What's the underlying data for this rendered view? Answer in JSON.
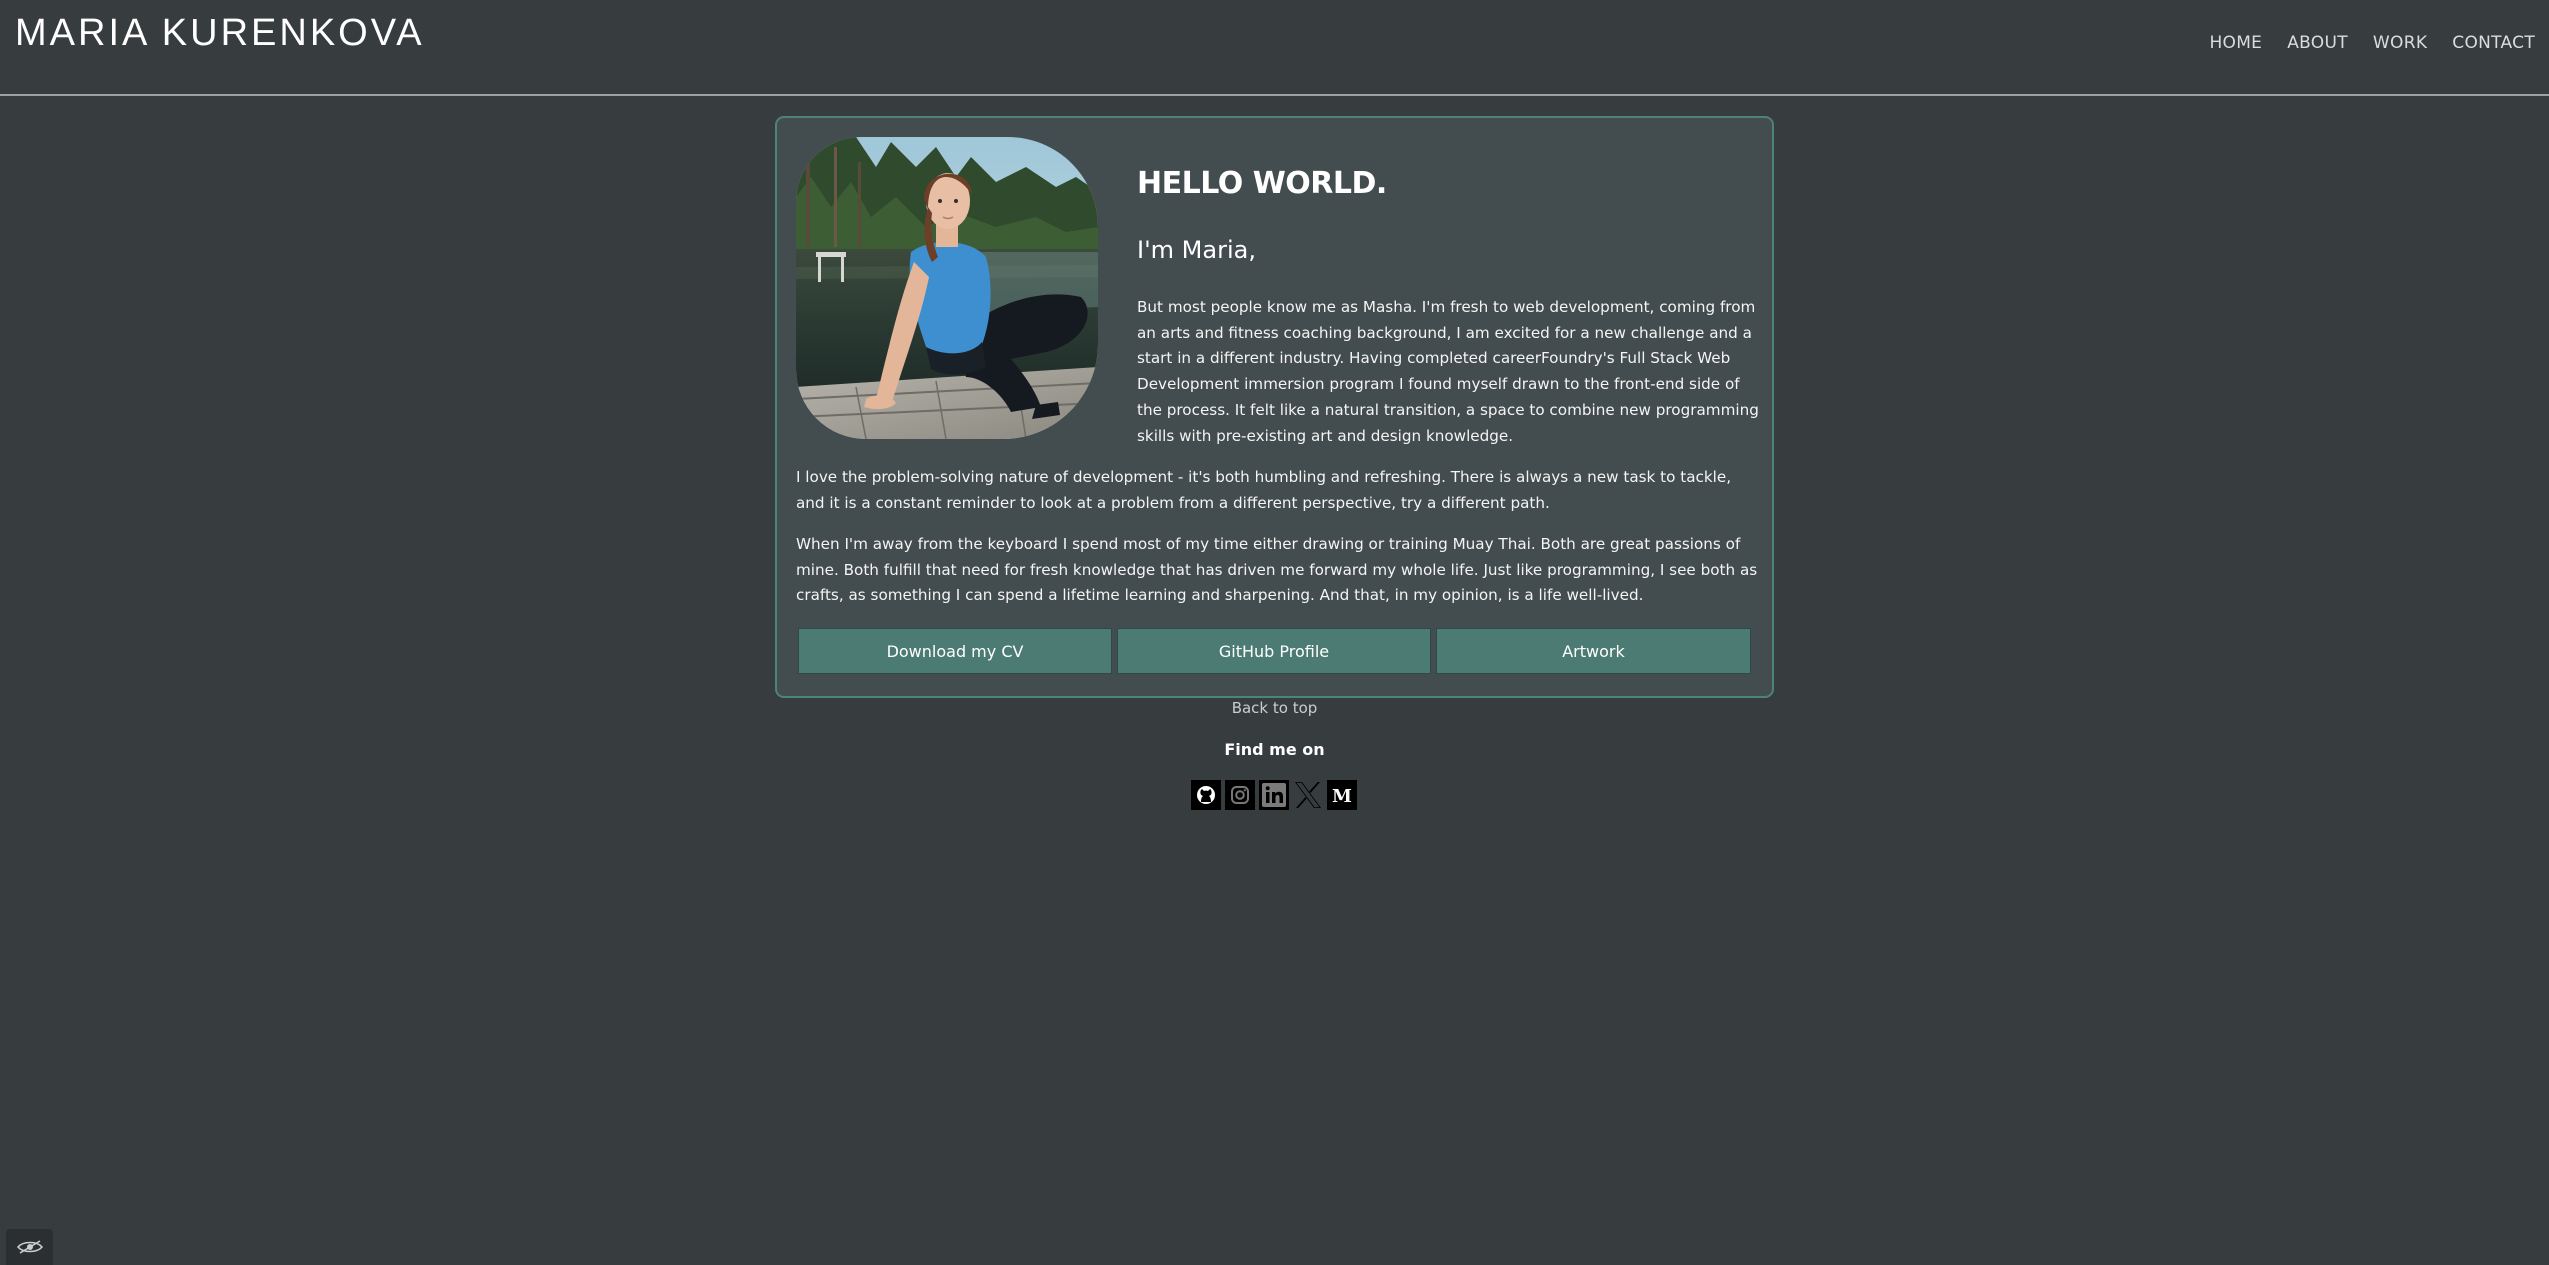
{
  "header": {
    "title": "MARIA KURENKOVA",
    "nav": [
      "HOME",
      "ABOUT",
      "WORK",
      "CONTACT"
    ]
  },
  "about": {
    "heading": "HELLO WORLD.",
    "subheading": "I'm Maria,",
    "paragraphs": [
      "But most people know me as Masha. I'm fresh to web development, coming from an arts and fitness coaching background, I am excited for a new challenge and a start in a different industry. Having completed careerFoundry's Full Stack Web Development immersion program I found myself drawn to the front-end side of the process. It felt like a natural transition, a space to combine new programming skills with pre-existing art and design knowledge.",
      "I love the problem-solving nature of development - it's both humbling and refreshing. There is always a new task to tackle, and it is a constant reminder to look at a problem from a different perspective, try a different path.",
      "When I'm away from the keyboard I spend most of my time either drawing or training Muay Thai. Both are great passions of mine. Both fulfill that need for fresh knowledge that has driven me forward my whole life. Just like programming, I see both as crafts, as something I can spend a lifetime learning and sharpening. And that, in my opinion, is a life well-lived."
    ],
    "buttons": [
      "Download my CV",
      "GitHub Profile",
      "Artwork"
    ]
  },
  "footer": {
    "back_to_top": "Back to top",
    "find_me": "Find me on",
    "socials": [
      "github-icon",
      "instagram-icon",
      "linkedin-icon",
      "x-icon",
      "medium-icon"
    ]
  },
  "colors": {
    "background": "#373c3e",
    "card": "#434c4e",
    "card_border": "#4f8379",
    "button": "#4c7b73"
  }
}
